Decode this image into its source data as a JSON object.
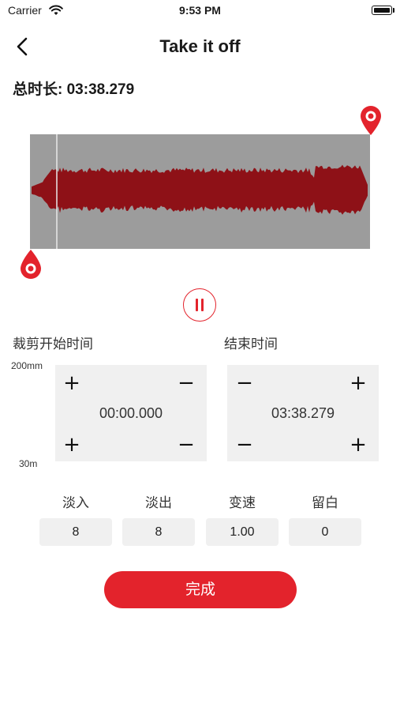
{
  "status_bar": {
    "carrier": "Carrier",
    "time": "9:53 PM"
  },
  "nav": {
    "title": "Take it off"
  },
  "total_duration": {
    "label": "总时长: 03:38.279"
  },
  "waveform": {
    "fill_color": "#8e1117",
    "background": "#9c9c9c",
    "playhead_fraction": 0.08
  },
  "trim": {
    "start_label": "裁剪开始时间",
    "end_label": "结束时间",
    "scale_top": "200mm",
    "scale_bottom": "30m",
    "start_value": "00:00.000",
    "end_value": "03:38.279"
  },
  "params": [
    {
      "label": "淡入",
      "value": "8"
    },
    {
      "label": "淡出",
      "value": "8"
    },
    {
      "label": "变速",
      "value": "1.00"
    },
    {
      "label": "留白",
      "value": "0"
    }
  ],
  "done_button": "完成",
  "accent": "#e3232c"
}
